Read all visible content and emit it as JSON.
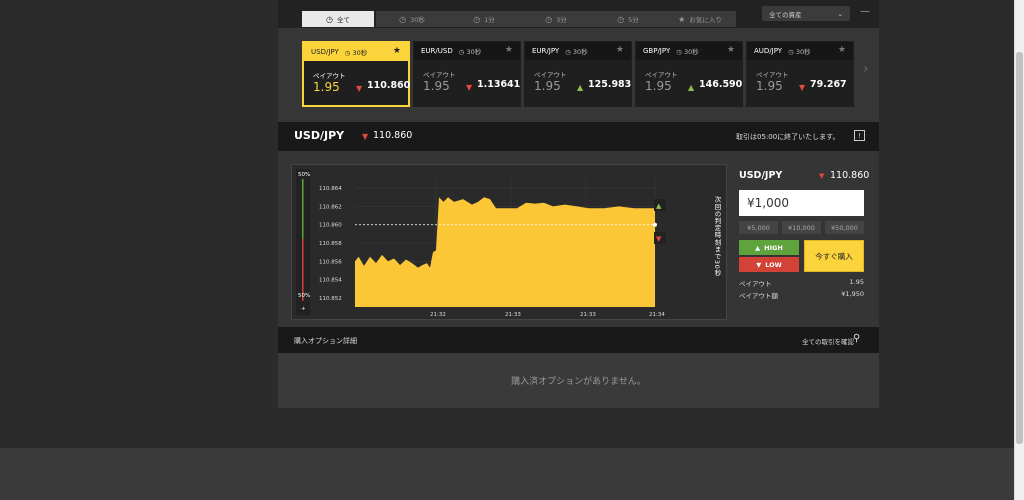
{
  "tabs": [
    {
      "icon": "◷",
      "label": "全て",
      "active": true
    },
    {
      "icon": "◷",
      "label": "30秒",
      "active": false
    },
    {
      "icon": "◷",
      "label": "1分",
      "active": false
    },
    {
      "icon": "◷",
      "label": "3分",
      "active": false
    },
    {
      "icon": "◷",
      "label": "5分",
      "active": false
    },
    {
      "icon": "★",
      "label": "お気に入り",
      "active": false
    }
  ],
  "asset_select": {
    "value": "全ての資産",
    "caret": "⌄"
  },
  "menu_label": "—",
  "cards": [
    {
      "pair": "USD/JPY",
      "time": "◷ 30秒",
      "payout_label": "ペイアウト",
      "payout": "1.95",
      "trend": "down",
      "rate": "110.860",
      "active": true
    },
    {
      "pair": "EUR/USD",
      "time": "◷ 30秒",
      "payout_label": "ペイアウト",
      "payout": "1.95",
      "trend": "down",
      "rate": "1.13641",
      "active": false
    },
    {
      "pair": "EUR/JPY",
      "time": "◷ 30秒",
      "payout_label": "ペイアウト",
      "payout": "1.95",
      "trend": "up",
      "rate": "125.983",
      "active": false
    },
    {
      "pair": "GBP/JPY",
      "time": "◷ 30秒",
      "payout_label": "ペイアウト",
      "payout": "1.95",
      "trend": "up",
      "rate": "146.590",
      "active": false
    },
    {
      "pair": "AUD/JPY",
      "time": "◷ 30秒",
      "payout_label": "ペイアウト",
      "payout": "1.95",
      "trend": "down",
      "rate": "79.267",
      "active": false
    }
  ],
  "instrument": {
    "title": "USD/JPY",
    "trend": "down",
    "rate": "110.860",
    "notice": "取引は05:00に終了いたします。",
    "info_icon": "!"
  },
  "chart_data": {
    "type": "area",
    "y_ticks": [
      "110.864",
      "110.862",
      "110.860",
      "110.858",
      "110.856",
      "110.854",
      "110.852"
    ],
    "x_ticks": [
      "21:32",
      "21:33",
      "21:33",
      "21:34"
    ],
    "ylim": [
      110.851,
      110.865
    ],
    "current_rate": 110.86,
    "sentiment_top": "50%",
    "sentiment_bottom": "50%",
    "countdown_label": "次回の判定時刻まで30秒",
    "color": "#fbc736",
    "points": [
      [
        0.0,
        110.856
      ],
      [
        0.012,
        110.8565
      ],
      [
        0.03,
        110.8555
      ],
      [
        0.05,
        110.8565
      ],
      [
        0.07,
        110.8558
      ],
      [
        0.09,
        110.8567
      ],
      [
        0.11,
        110.856
      ],
      [
        0.13,
        110.8563
      ],
      [
        0.15,
        110.8556
      ],
      [
        0.17,
        110.8562
      ],
      [
        0.19,
        110.8558
      ],
      [
        0.21,
        110.8553
      ],
      [
        0.225,
        110.8556
      ],
      [
        0.24,
        110.8558
      ],
      [
        0.25,
        110.8553
      ],
      [
        0.26,
        110.857
      ],
      [
        0.27,
        110.8572
      ],
      [
        0.28,
        110.863
      ],
      [
        0.295,
        110.8625
      ],
      [
        0.31,
        110.863
      ],
      [
        0.33,
        110.8625
      ],
      [
        0.36,
        110.8628
      ],
      [
        0.39,
        110.8622
      ],
      [
        0.41,
        110.8625
      ],
      [
        0.43,
        110.863
      ],
      [
        0.45,
        110.8628
      ],
      [
        0.47,
        110.8618
      ],
      [
        0.5,
        110.8618
      ],
      [
        0.54,
        110.8618
      ],
      [
        0.57,
        110.8624
      ],
      [
        0.6,
        110.8623
      ],
      [
        0.63,
        110.8624
      ],
      [
        0.66,
        110.862
      ],
      [
        0.7,
        110.8622
      ],
      [
        0.74,
        110.862
      ],
      [
        0.78,
        110.8618
      ],
      [
        0.83,
        110.8618
      ],
      [
        0.88,
        110.862
      ],
      [
        0.93,
        110.8618
      ],
      [
        1.0,
        110.8618
      ]
    ]
  },
  "order": {
    "title": "USD/JPY",
    "trend": "down",
    "rate": "110.860",
    "amount": "¥1,000",
    "presets": [
      "¥5,000",
      "¥10,000",
      "¥50,000"
    ],
    "high_label": "HIGH",
    "low_label": "LOW",
    "buy_label": "今すぐ購入",
    "payout_label": "ペイアウト",
    "payout_value": "1.95",
    "payout_amount_label": "ペイアウト額",
    "payout_amount_value": "¥1,950"
  },
  "options": {
    "title": "購入オプション詳細",
    "link": "全ての取引を確認",
    "empty": "購入済オプションがありません。"
  },
  "icons": {
    "up": "▲",
    "down": "▼",
    "star": "★",
    "next": "›",
    "search": "⚲"
  },
  "colors": {
    "accent": "#fbd43b",
    "high": "#5fa33c",
    "low": "#d24236",
    "up_arrow": "#8bc34a",
    "down_arrow": "#e04a3f"
  }
}
